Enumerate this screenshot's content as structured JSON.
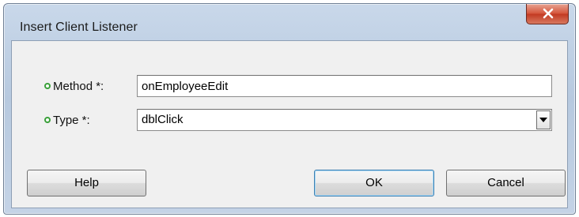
{
  "dialog": {
    "title": "Insert Client Listener",
    "close_icon": "close-icon"
  },
  "form": {
    "method": {
      "label": "Method *:",
      "value": "onEmployeeEdit",
      "required": true
    },
    "type": {
      "label": "Type *:",
      "selected": "dblClick",
      "required": true
    }
  },
  "buttons": {
    "help": "Help",
    "ok": "OK",
    "cancel": "Cancel"
  },
  "colors": {
    "required_indicator": "#3aa03a",
    "close_button": "#c9452b",
    "titlebar": "#c4d3e6"
  }
}
